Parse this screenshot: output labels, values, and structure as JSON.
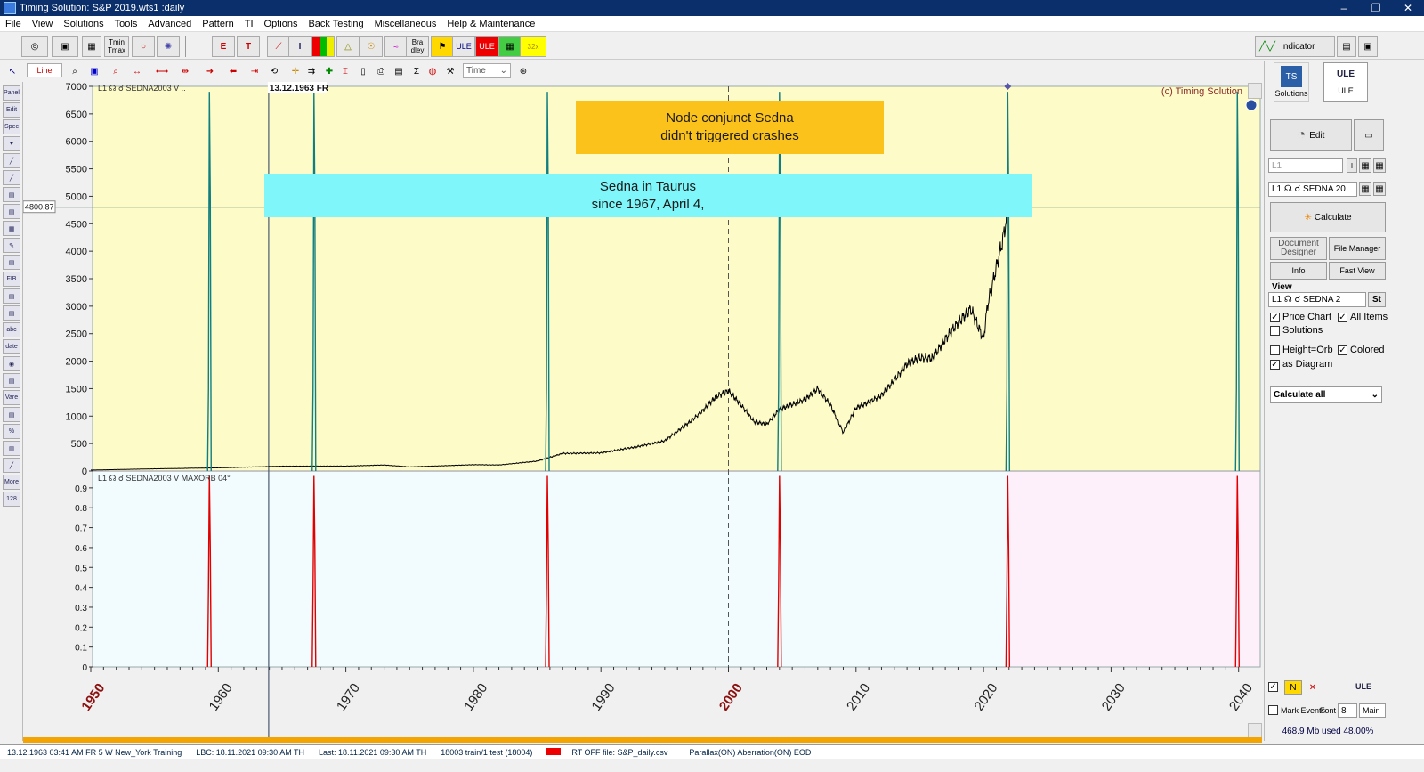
{
  "window": {
    "title": "Timing Solution:  S&P 2019.wts1 :daily",
    "min": "–",
    "max": "❐",
    "close": "✕"
  },
  "menu": [
    "File",
    "View",
    "Solutions",
    "Tools",
    "Advanced",
    "Pattern",
    "TI",
    "Options",
    "Back Testing",
    "Miscellaneous",
    "Help & Maintenance"
  ],
  "toolbar": {
    "tminmax": "Tmin Tmax",
    "bradley": "Bra dley",
    "ule": "ULE",
    "ule2": "ULE",
    "speed": "32x",
    "indicator": "Indicator",
    "line": "Line",
    "time_select": "Time"
  },
  "left_tools": [
    "Panel",
    "Edit",
    "Spec",
    "♥",
    "╱",
    "╱",
    "▤",
    "▤",
    "▦",
    "✎",
    "▤",
    "FIB",
    "▤",
    "▤",
    "abc",
    "date",
    "◉",
    "▤",
    "Vare",
    "▤",
    "%",
    "▥",
    "╱",
    "More",
    "128"
  ],
  "chart": {
    "label_top": "L1  ☊ ☌ SEDNA2003 V ..",
    "label_bottom": "L1 ☊ ☌ SEDNA2003 V  MAXORB 04°",
    "cursor_date": "13.12.1963 FR",
    "copyright": "(c) Timing Solution",
    "price_readout": "4800.87",
    "y_top_ticks": [
      "7000",
      "6500",
      "6000",
      "5500",
      "5000",
      "4500",
      "4000",
      "3500",
      "3000",
      "2500",
      "2000",
      "1500",
      "1000",
      "500",
      "0"
    ],
    "y_bottom_ticks": [
      "0.9",
      "0.8",
      "0.7",
      "0.6",
      "0.5",
      "0.4",
      "0.3",
      "0.2",
      "0.1",
      "0"
    ],
    "x_ticks": [
      "1950",
      "1960",
      "1970",
      "1980",
      "1990",
      "2000",
      "2010",
      "2020",
      "2030",
      "2040"
    ],
    "annotations": [
      {
        "lines": [
          "Node conjunct Sedna",
          "didn't triggered crashes"
        ],
        "color": "#fbc21c"
      },
      {
        "lines": [
          "Sedna in Taurus",
          "since 1967, April 4,"
        ],
        "color": "#7ef6fa"
      }
    ],
    "colors": {
      "top_bg": "#fdfbc8",
      "bottom_bg": "#f2fbfd",
      "future_bg": "#fdf0fb",
      "price": "#000000",
      "upper_spike": "#0f7e80",
      "lower_spike": "#e00000",
      "axis_year": "#8b1010"
    }
  },
  "right_panel": {
    "solutions": "Solutions",
    "ule": "ULE",
    "edit": "Edit",
    "l1_field": "L1",
    "l1_select": "L1  ☊ ☌ SEDNA 20",
    "calculate": "Calculate",
    "document_designer": "Document Designer",
    "file_manager": "File Manager",
    "info": "Info",
    "fast_view": "Fast View",
    "view_label": "View",
    "view_select": "L1  ☊ ☌ SEDNA 2",
    "st": "St",
    "price_chart": "Price Chart",
    "all_items": "All Items",
    "solutions_cb": "Solutions",
    "height_orb": "Height=Orb",
    "colored": "Colored",
    "as_diagram": "as Diagram",
    "calculate_all": "Calculate all",
    "bottom_ule": "ULE",
    "mark_events": "Mark Events",
    "font_label": "Font",
    "font_size": "8",
    "main_select": "Main",
    "memory": "468.9 Mb used 48.00%"
  },
  "status": [
    "13.12.1963  03:41 AM FR  5 W New_York  Training",
    "LBC: 18.11.2021  09:30 AM TH",
    "Last: 18.11.2021  09:30 AM TH",
    "18003 train/1 test (18004)",
    "RT OFF file: S&P_daily.csv",
    "Parallax(ON) Aberration(ON) EOD"
  ]
}
